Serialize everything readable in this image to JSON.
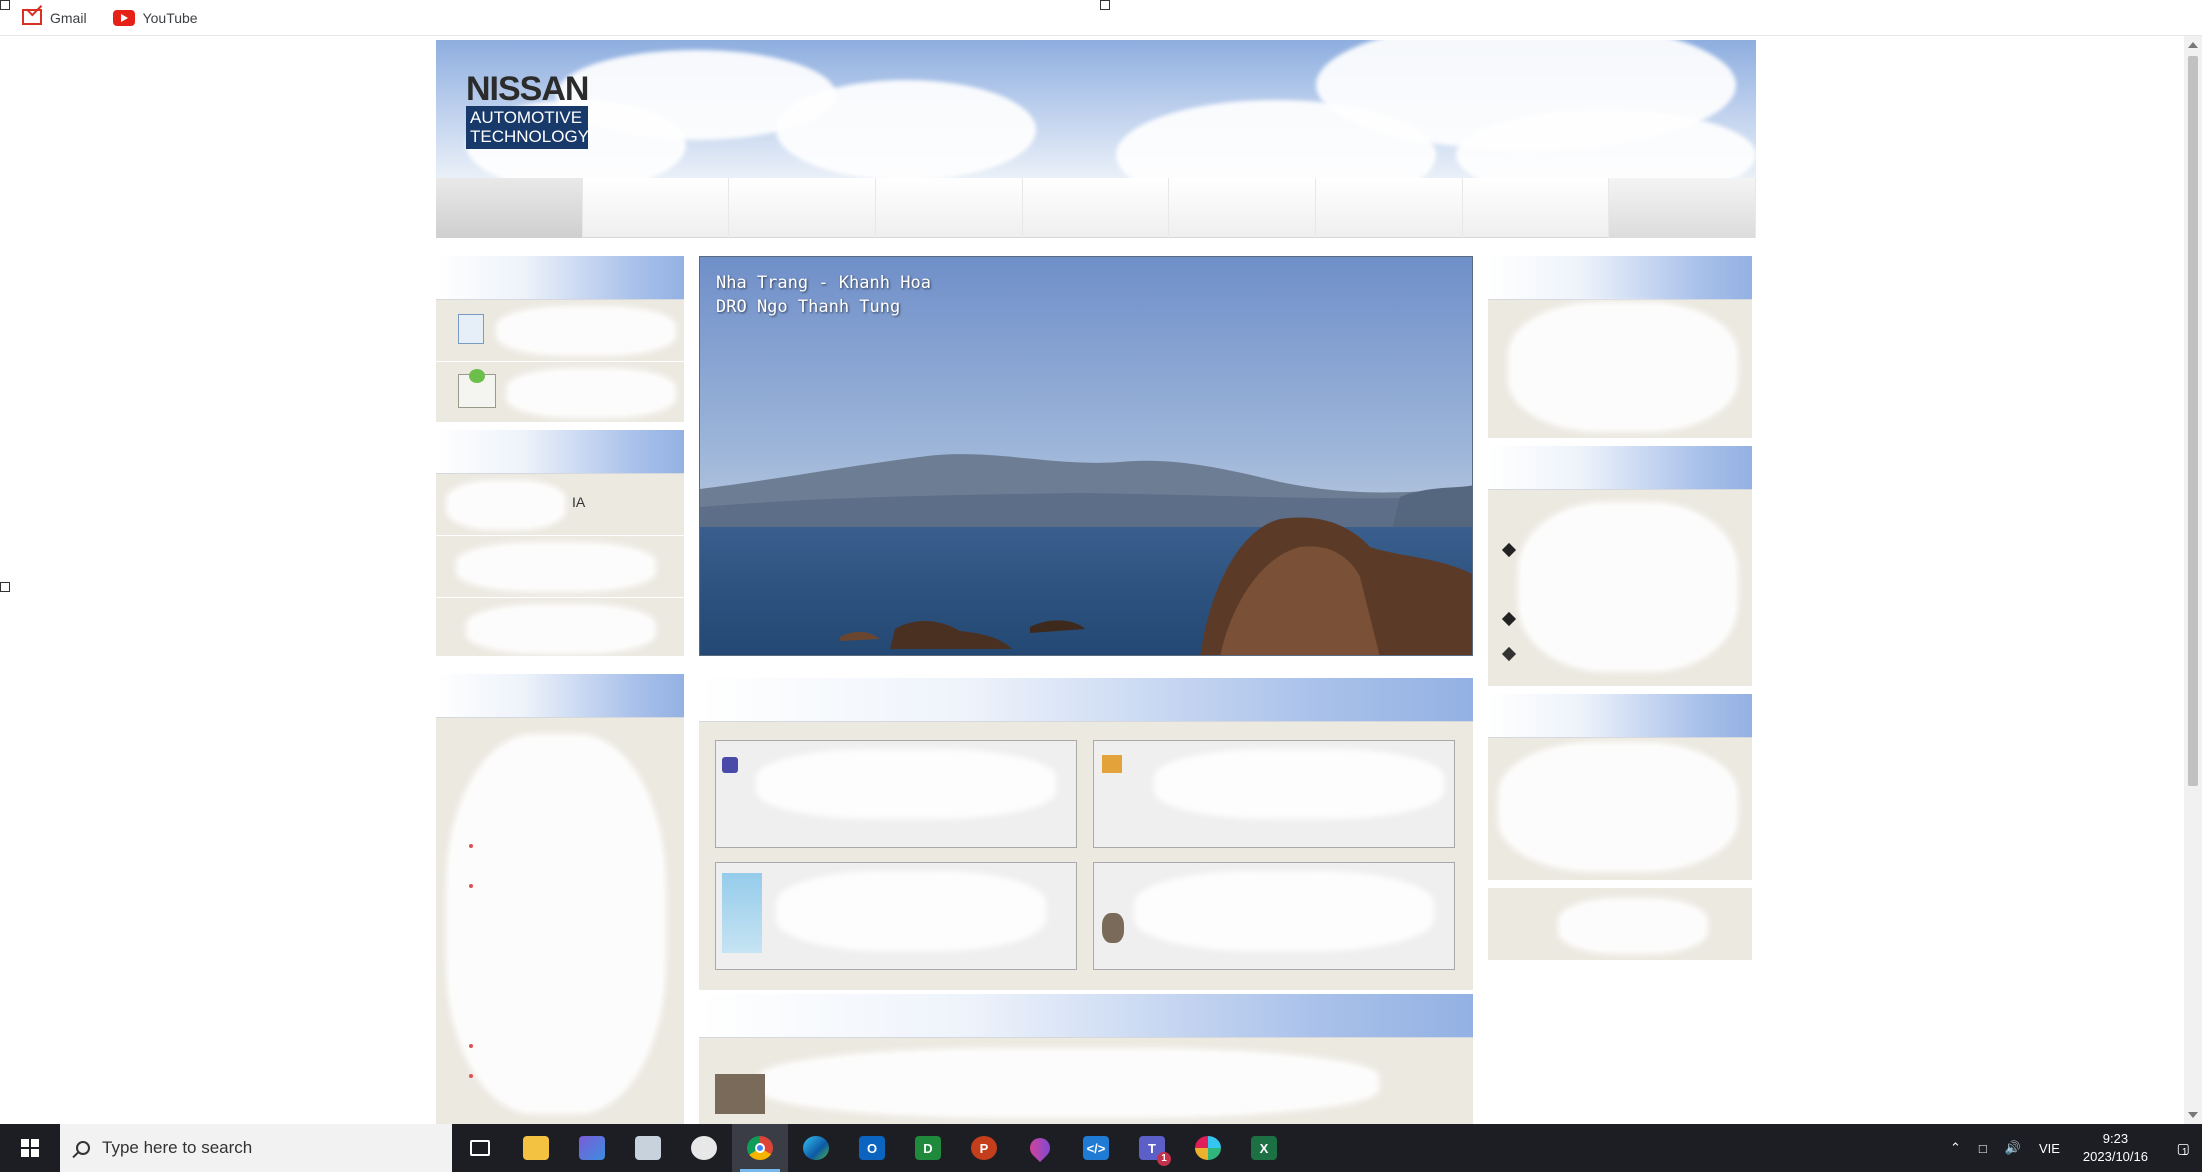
{
  "bookmarks": [
    {
      "label": "Gmail",
      "icon": "gmail-icon"
    },
    {
      "label": "YouTube",
      "icon": "youtube-icon"
    }
  ],
  "site": {
    "logo": {
      "name": "NISSAN",
      "subtitle_line1": "AUTOMOTIVE",
      "subtitle_line2": "TECHNOLOGY"
    },
    "photo": {
      "caption_line1": "Nha Trang - Khanh Hoa",
      "caption_line2": "DRO Ngo Thanh Tung"
    },
    "left_panel_text": "IA"
  },
  "taskbar": {
    "search_placeholder": "Type here to search",
    "apps": [
      "task-view",
      "file-explorer",
      "video-app",
      "photos",
      "paint",
      "chrome",
      "edge",
      "outlook",
      "dynamics",
      "powerpoint",
      "maps",
      "vscode",
      "teams",
      "slack",
      "excel"
    ],
    "teams_badge": "1",
    "language": "VIE",
    "time": "9:23",
    "date": "2023/10/16",
    "notification_count": "1"
  },
  "colors": {
    "taskbar": "#1c1e24",
    "logo_box": "#183a6b",
    "panel_bg": "#ece9e1",
    "header_sky": "#8eaedf"
  }
}
